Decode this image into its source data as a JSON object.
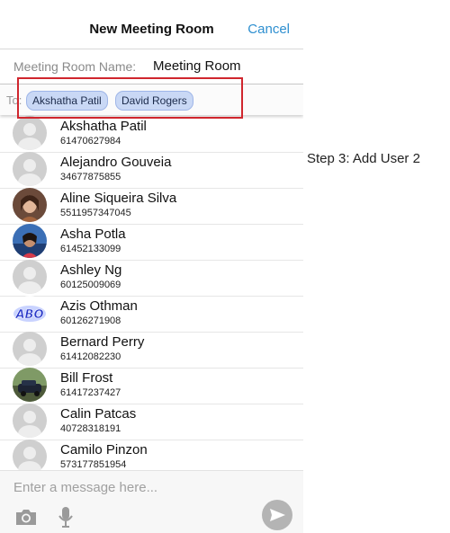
{
  "header": {
    "title": "New Meeting Room",
    "cancel_label": "Cancel"
  },
  "room": {
    "name_label": "Meeting Room Name:",
    "name_value": "Meeting Room"
  },
  "to": {
    "label": "To:",
    "chips": [
      "Akshatha Patil",
      "David Rogers"
    ]
  },
  "contacts": [
    {
      "name": "Akshatha Patil",
      "number": "61470627984",
      "avatar": "default-avatar-icon"
    },
    {
      "name": "Alejandro Gouveia",
      "number": "34677875855",
      "avatar": "default-avatar-icon"
    },
    {
      "name": "Aline Siqueira Silva",
      "number": "5511957347045",
      "avatar": "photo-avatar"
    },
    {
      "name": "Asha Potla",
      "number": "61452133099",
      "avatar": "photo-avatar"
    },
    {
      "name": "Ashley Ng",
      "number": "60125009069",
      "avatar": "default-avatar-icon"
    },
    {
      "name": "Azis Othman",
      "number": "60126271908",
      "avatar": "abo-logo-avatar"
    },
    {
      "name": "Bernard Perry",
      "number": "61412082230",
      "avatar": "default-avatar-icon"
    },
    {
      "name": "Bill Frost",
      "number": "61417237427",
      "avatar": "photo-avatar"
    },
    {
      "name": "Calin Patcas",
      "number": "40728318191",
      "avatar": "default-avatar-icon"
    },
    {
      "name": "Camilo Pinzon",
      "number": "573177851954",
      "avatar": "default-avatar-icon"
    }
  ],
  "composer": {
    "placeholder": "Enter a message here..."
  },
  "annotation": {
    "text": "Step 3: Add User 2"
  },
  "colors": {
    "accent": "#2e8fd0",
    "highlight": "#d0262e",
    "chip_bg": "#c9d8f5"
  }
}
